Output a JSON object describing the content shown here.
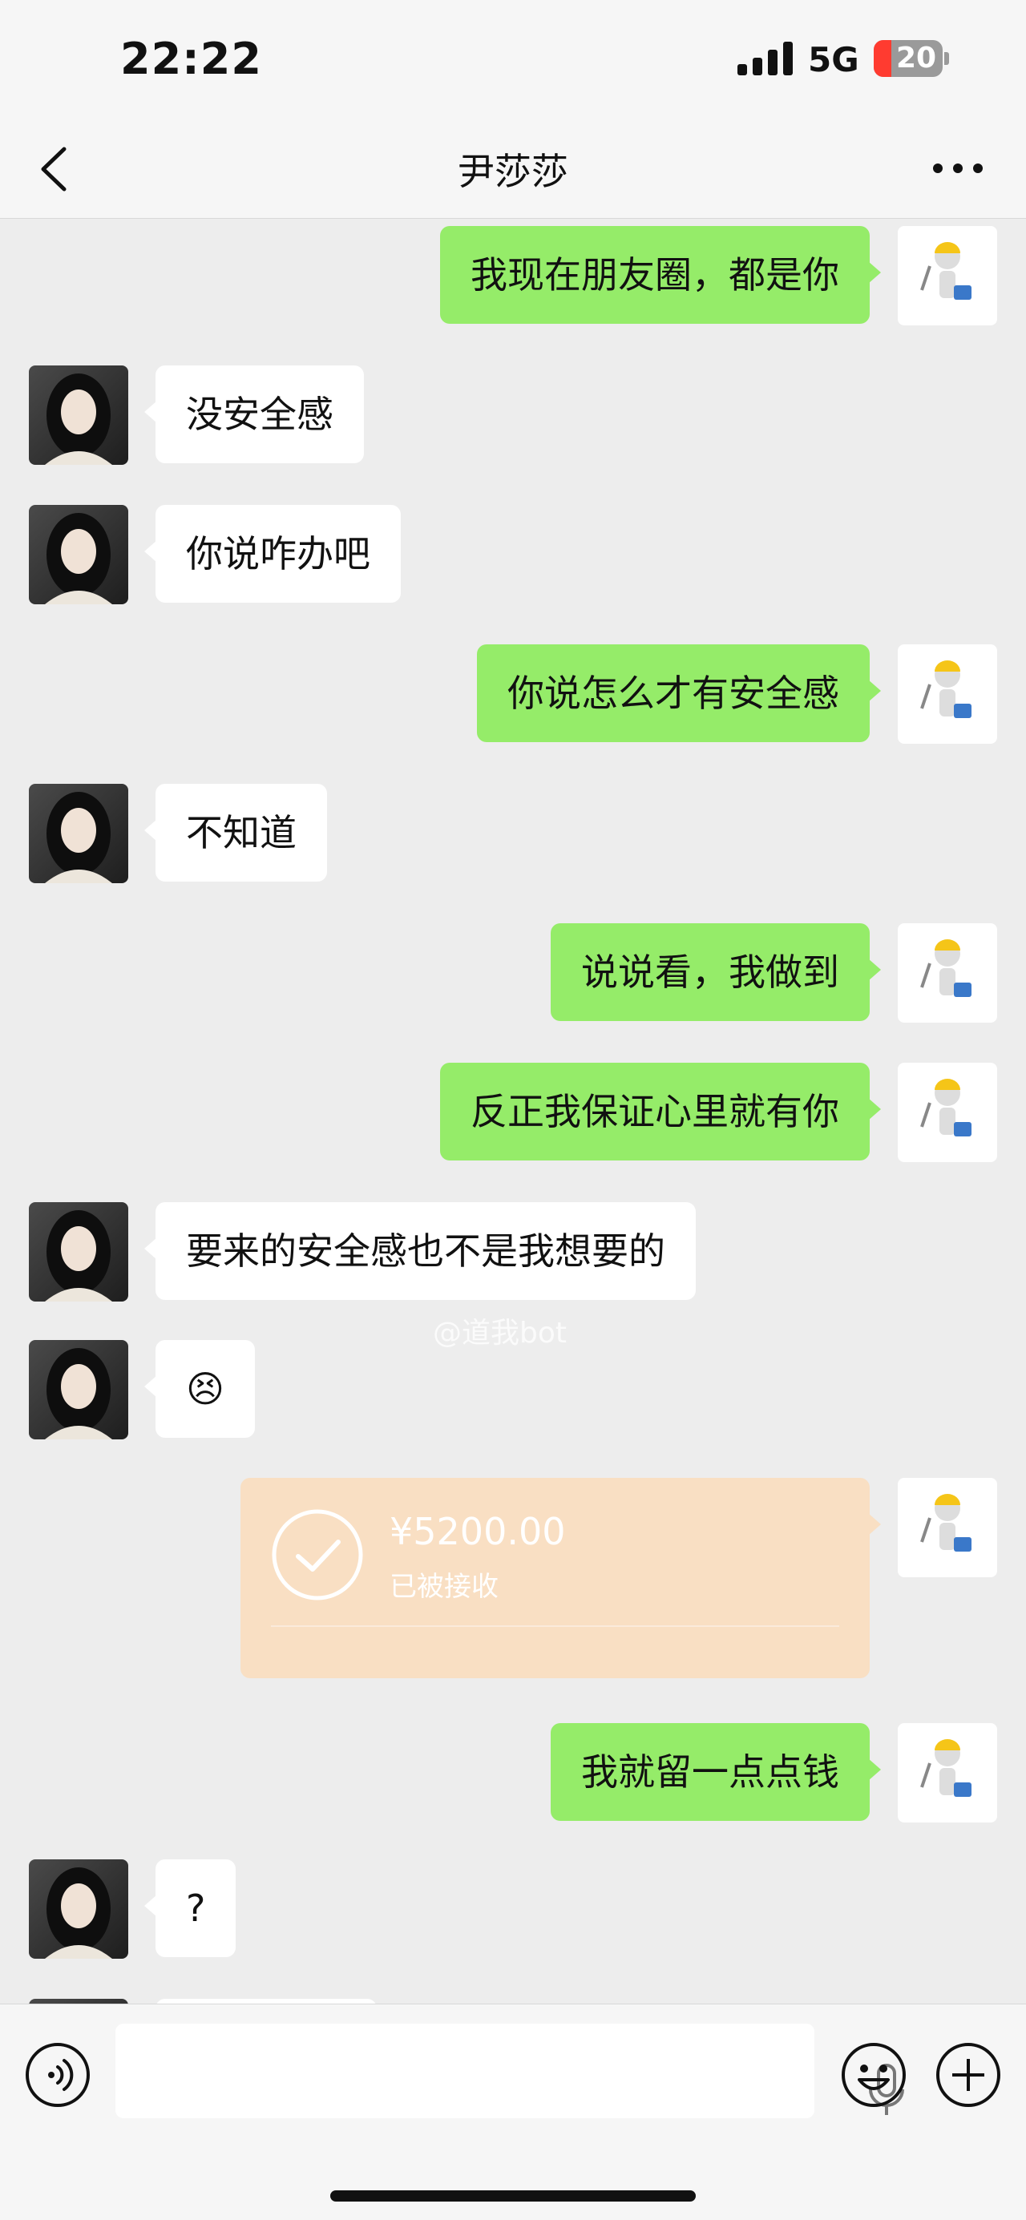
{
  "status_bar": {
    "time": "22:22",
    "network": "5G",
    "battery": "20"
  },
  "header": {
    "title": "尹莎莎"
  },
  "messages": [
    {
      "side": "out",
      "text": "我现在朋友圈，都是你"
    },
    {
      "side": "in",
      "text": "没安全感"
    },
    {
      "side": "in",
      "text": "你说咋办吧"
    },
    {
      "side": "out",
      "text": "你说怎么才有安全感"
    },
    {
      "side": "in",
      "text": "不知道"
    },
    {
      "side": "out",
      "text": "说说看，我做到"
    },
    {
      "side": "out",
      "text": "反正我保证心里就有你"
    },
    {
      "side": "in",
      "text": "要来的安全感也不是我想要的"
    },
    {
      "side": "in",
      "text": "😣"
    },
    {
      "side": "out",
      "text": "我就留一点点钱"
    },
    {
      "side": "in",
      "text": "?"
    }
  ],
  "transfer": {
    "amount": "¥5200.00",
    "status": "已被接收"
  },
  "watermark": "@道我bot",
  "colors": {
    "out_bubble": "#95ec69",
    "in_bubble": "#ffffff",
    "transfer_bg": "#f9dfc3",
    "chat_bg": "#ededed"
  },
  "icons": [
    "back-arrow-icon",
    "more-icon",
    "voice-toggle-icon",
    "microphone-icon",
    "emoji-icon",
    "add-icon",
    "check-icon"
  ]
}
